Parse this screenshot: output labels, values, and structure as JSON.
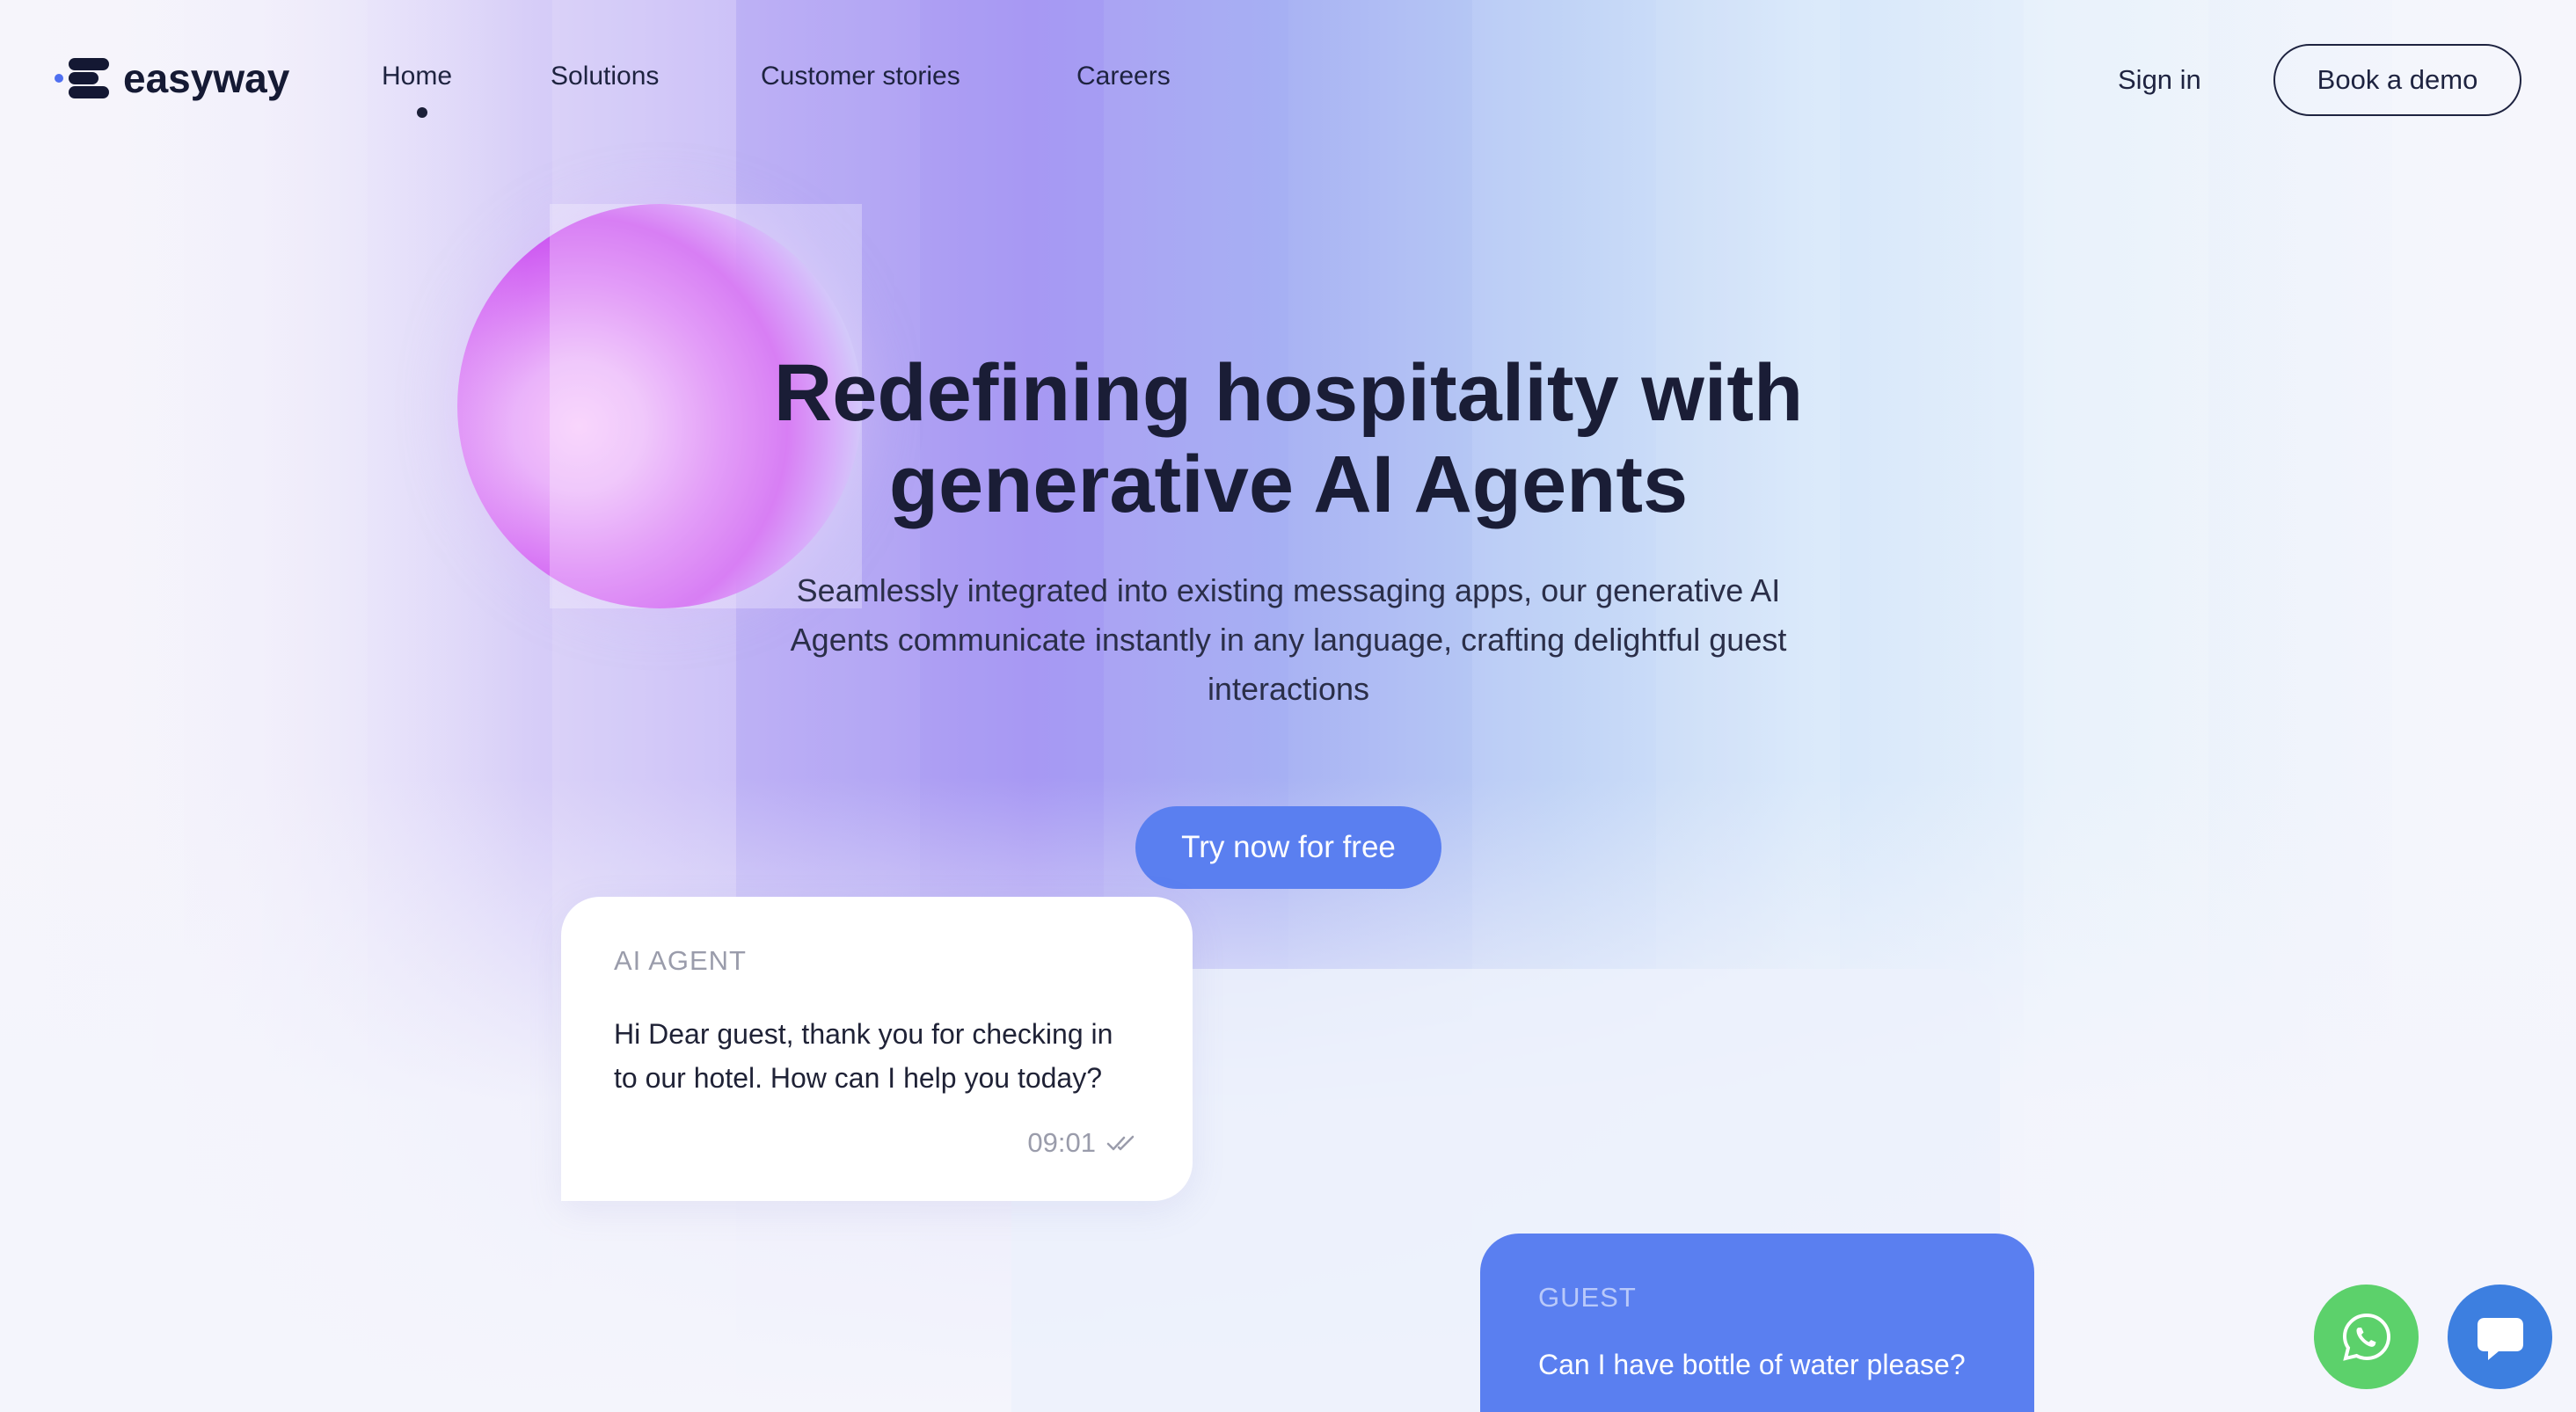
{
  "brand": {
    "name": "easyway",
    "accent": "#5a7ff0",
    "dark": "#1a1d36"
  },
  "nav": {
    "links": [
      {
        "label": "Home",
        "active": true
      },
      {
        "label": "Solutions",
        "active": false
      },
      {
        "label": "Customer stories",
        "active": false
      },
      {
        "label": "Careers",
        "active": false
      }
    ],
    "sign_in": "Sign in",
    "book_demo": "Book a demo"
  },
  "hero": {
    "headline_line1": "Redefining hospitality with",
    "headline_line2": "generative AI Agents",
    "subtext_line1": "Seamlessly integrated into existing messaging apps, our generative AI",
    "subtext_line2": "Agents communicate instantly in any language, crafting delightful guest",
    "subtext_line3": "interactions",
    "cta": "Try now for free"
  },
  "chat": {
    "ai_message": {
      "sender": "AI AGENT",
      "text_line1": "Hi Dear guest, thank you for checking in",
      "text_line2": "to our hotel. How can I help you today?",
      "time": "09:01",
      "status_icon": "double-check-icon"
    },
    "guest_message": {
      "sender": "GUEST",
      "text": "Can I have bottle of water please?"
    }
  },
  "floating": {
    "whatsapp": {
      "icon": "whatsapp-icon",
      "color": "#5cd16b"
    },
    "live_chat": {
      "icon": "chat-bubble-icon",
      "color": "#3d7fe0"
    }
  }
}
